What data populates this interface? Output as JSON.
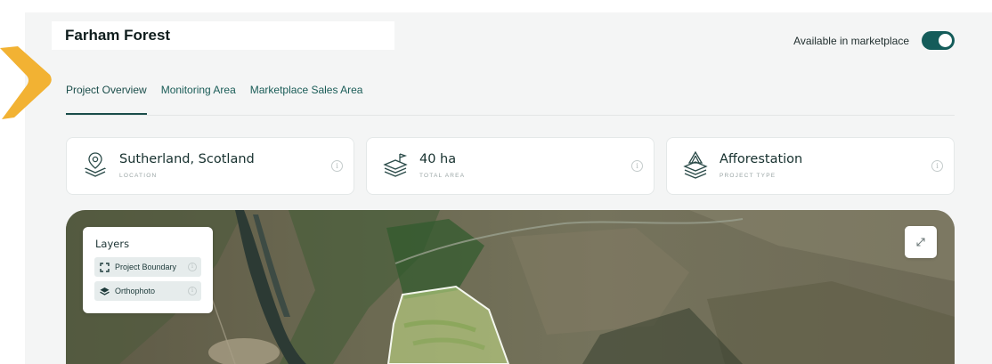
{
  "project": {
    "title": "Farham Forest"
  },
  "marketplace": {
    "label": "Available in marketplace",
    "enabled": true
  },
  "tabs": [
    {
      "label": "Project Overview",
      "active": true
    },
    {
      "label": "Monitoring Area",
      "active": false
    },
    {
      "label": "Marketplace Sales Area",
      "active": false
    }
  ],
  "cards": [
    {
      "value": "Sutherland, Scotland",
      "label": "LOCATION",
      "icon": "location-pin-icon"
    },
    {
      "value": "40 ha",
      "label": "TOTAL AREA",
      "icon": "area-flag-icon"
    },
    {
      "value": "Afforestation",
      "label": "PROJECT TYPE",
      "icon": "tree-layers-icon"
    }
  ],
  "layers": {
    "title": "Layers",
    "items": [
      {
        "label": "Project Boundary",
        "icon": "boundary-icon"
      },
      {
        "label": "Orthophoto",
        "icon": "stack-icon"
      }
    ]
  },
  "info_glyph": "i",
  "colors": {
    "accent": "#145c5a",
    "tab_text": "#1a5c57",
    "arrow": "#f2b233",
    "boundary_fill": "#c9e48a"
  }
}
